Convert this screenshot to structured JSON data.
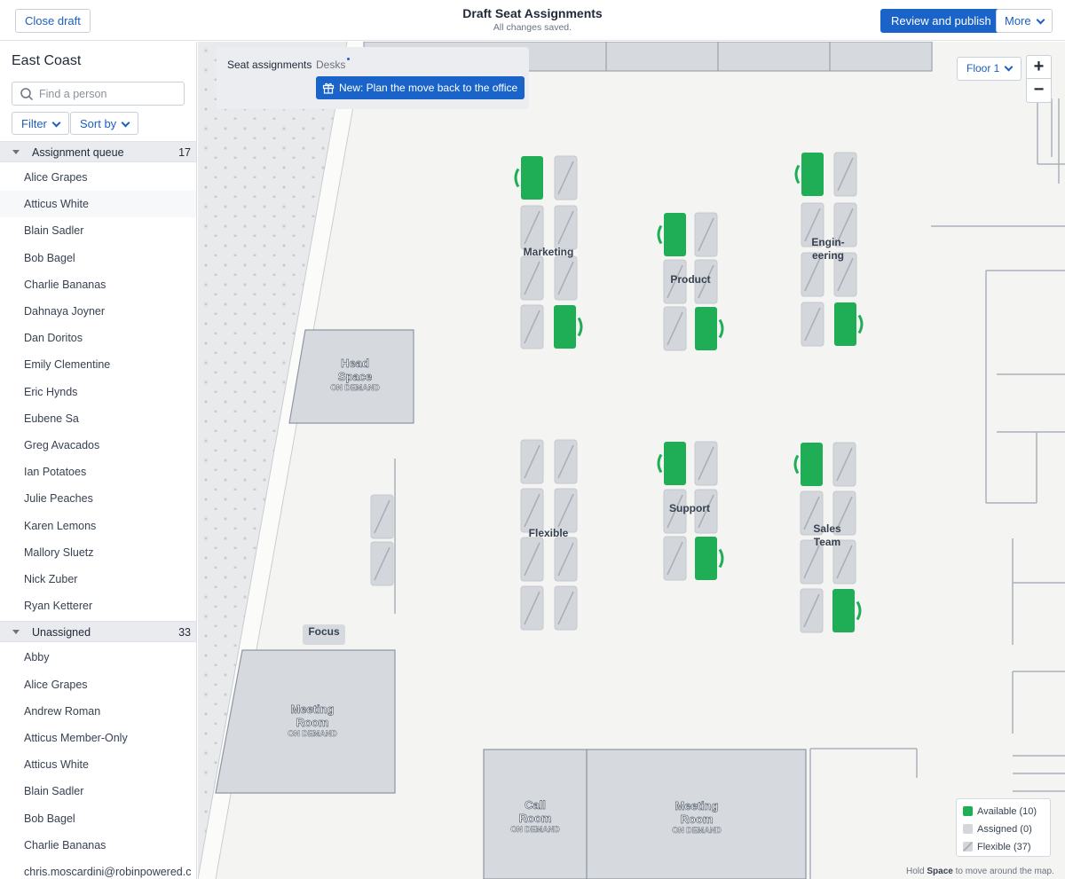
{
  "header": {
    "close_label": "Close draft",
    "title": "Draft Seat Assignments",
    "subtitle": "All changes saved.",
    "publish_label": "Review and publish",
    "more_label": "More"
  },
  "sidebar": {
    "title": "East Coast",
    "search_placeholder": "Find a person",
    "filter_label": "Filter",
    "sort_label": "Sort by",
    "queue": {
      "label": "Assignment queue",
      "count": "17",
      "people": [
        "Alice Grapes",
        "Atticus White",
        "Blain Sadler",
        "Bob Bagel",
        "Charlie Bananas",
        "Dahnaya Joyner",
        "Dan Doritos",
        "Emily Clementine",
        "Eric Hynds",
        "Eubene Sa",
        "Greg Avacados",
        "Ian Potatoes",
        "Julie Peaches",
        "Karen Lemons",
        "Mallory Sluetz",
        "Nick Zuber",
        "Ryan Ketterer"
      ]
    },
    "unassigned": {
      "label": "Unassigned",
      "count": "33",
      "people": [
        "Abby",
        "Alice Grapes",
        "Andrew Roman",
        "Atticus Member-Only",
        "Atticus White",
        "Blain Sadler",
        "Bob Bagel",
        "Charlie Bananas",
        "chris.moscardini@robinpowered.c"
      ]
    }
  },
  "map": {
    "tab_seats": "Seat assignments",
    "tab_desks": "Desks",
    "new_label": "New: Plan the move back to the office",
    "floor_label": "Floor 1",
    "zoom_in": "+",
    "zoom_out": "−",
    "zones": {
      "marketing": "Marketing",
      "product": "Product",
      "engineering_1": "Engin-",
      "engineering_2": "eering",
      "flexible": "Flexible",
      "support": "Support",
      "sales_1": "Sales",
      "sales_2": "Team",
      "focus": "Focus"
    },
    "rooms": {
      "head_1": "Head",
      "head_2": "Space",
      "meeting_1": "Meeting",
      "meeting_2": "Room",
      "call_1": "Call",
      "call_2": "Room",
      "on_demand": "ON DEMAND"
    },
    "legend": {
      "available": "Available (10)",
      "assigned": "Assigned (0)",
      "flexible": "Flexible (37)"
    },
    "hint_pre": "Hold",
    "hint_key": "Space",
    "hint_post": "to move around the map.",
    "colors": {
      "available": "#1fae55",
      "assigned": "#d3d6da",
      "accent": "#1a64c9"
    }
  }
}
